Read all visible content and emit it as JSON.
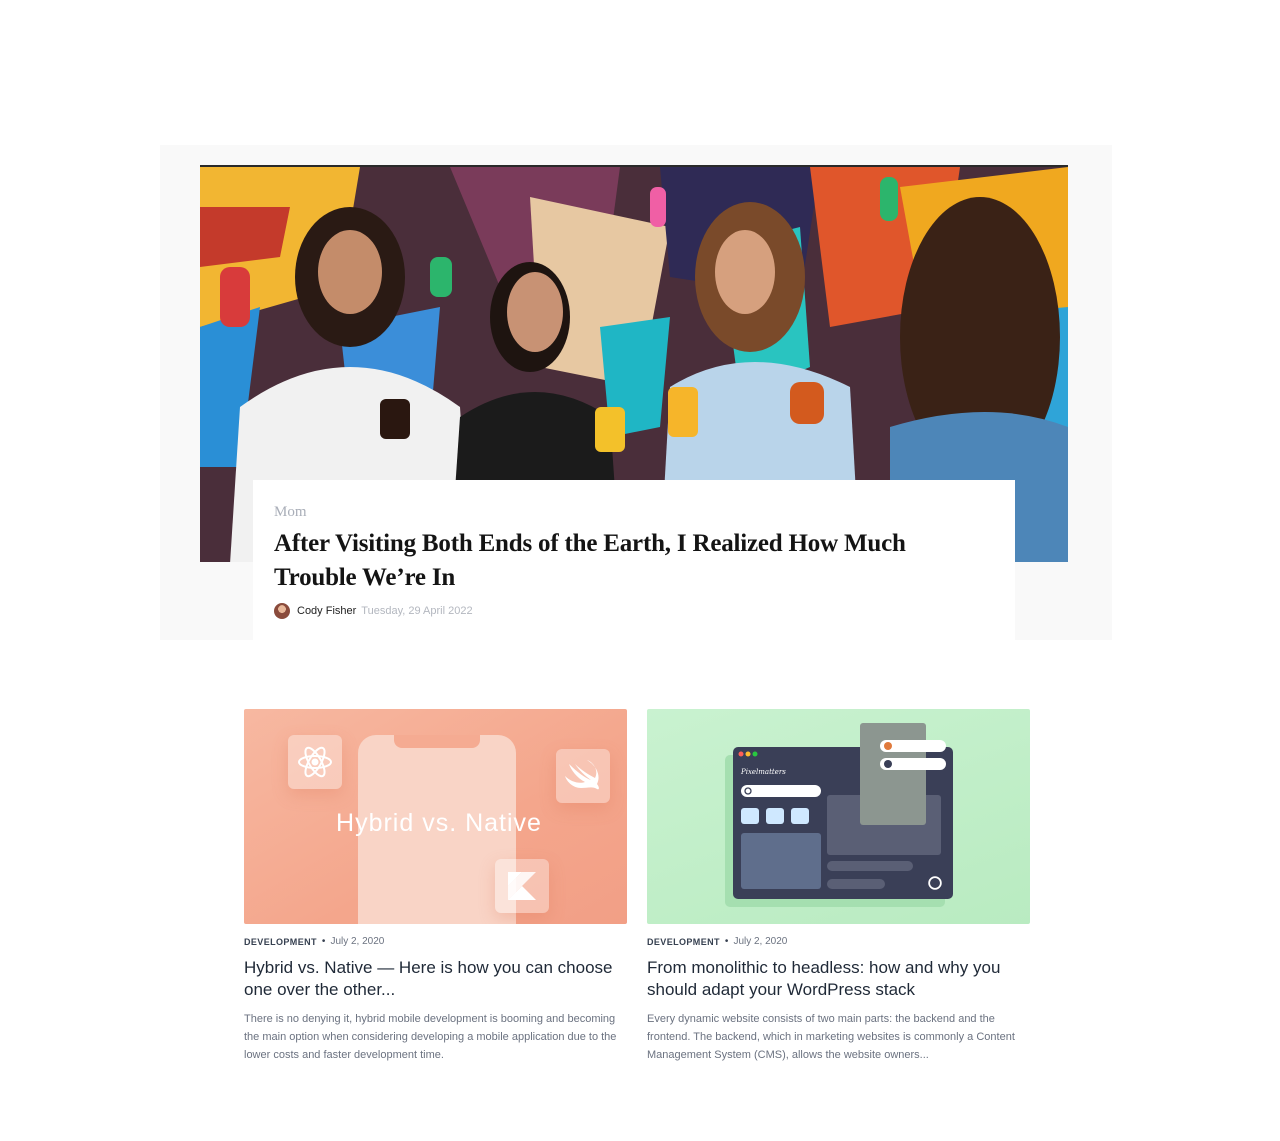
{
  "featured": {
    "category": "Mom",
    "title": "After Visiting Both Ends of the Earth, I Realized How Much Trouble We’re In",
    "author": "Cody Fisher",
    "date": "Tuesday, 29 April 2022"
  },
  "posts": [
    {
      "thumb_text": "Hybrid vs. Native",
      "category": "DEVELOPMENT",
      "date": "July 2, 2020",
      "title": "Hybrid vs. Native — Here is how you can choose one over the other...",
      "excerpt": "There is no denying it, hybrid mobile development is booming and becoming the main option when considering developing a mobile application due to the lower costs and faster development time."
    },
    {
      "thumb_brand": "Pixelmatters",
      "category": "DEVELOPMENT",
      "date": "July 2, 2020",
      "title": "From monolithic to headless: how and why you should adapt your WordPress stack",
      "excerpt": "Every dynamic website consists of two main parts: the backend and the frontend. The backend, which in marketing websites is commonly a Content Management System (CMS), allows the website owners..."
    }
  ],
  "colors": {
    "peach": "#f4a68c",
    "mint": "#b9ebc1",
    "dark_window": "#3a3f57"
  },
  "icons": [
    "react-icon",
    "swift-icon",
    "kotlin-icon",
    "search-icon",
    "wordpress-icon",
    "user-icon"
  ]
}
